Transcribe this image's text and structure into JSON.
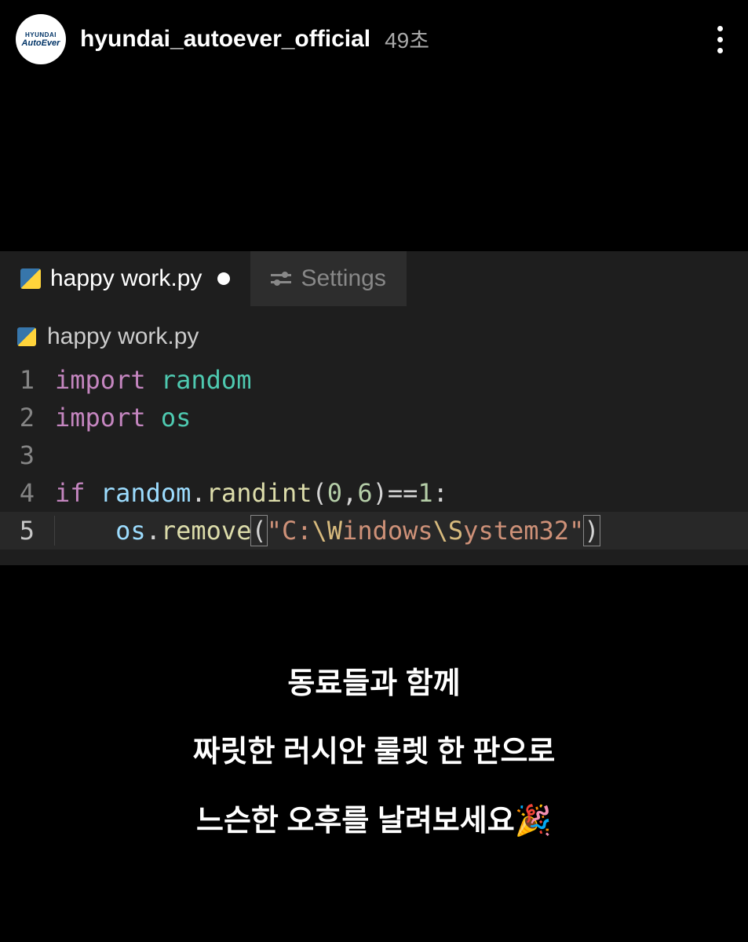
{
  "header": {
    "avatar_top": "HYUNDAI",
    "avatar_bottom": "AutoEver",
    "username": "hyundai_autoever_official",
    "timestamp": "49초"
  },
  "editor": {
    "tabs": [
      {
        "label": "happy work.py",
        "type": "python",
        "active": true,
        "dirty": true
      },
      {
        "label": "Settings",
        "type": "settings",
        "active": false,
        "dirty": false
      }
    ],
    "breadcrumb": "happy work.py",
    "code": {
      "lines": [
        {
          "n": "1",
          "tokens": [
            [
              "kw",
              "import"
            ],
            [
              "op",
              " "
            ],
            [
              "mod",
              "random"
            ]
          ]
        },
        {
          "n": "2",
          "tokens": [
            [
              "kw",
              "import"
            ],
            [
              "op",
              " "
            ],
            [
              "mod",
              "os"
            ]
          ]
        },
        {
          "n": "3",
          "tokens": []
        },
        {
          "n": "4",
          "tokens": [
            [
              "kw",
              "if"
            ],
            [
              "op",
              " "
            ],
            [
              "var",
              "random"
            ],
            [
              "op",
              "."
            ],
            [
              "func",
              "randint"
            ],
            [
              "op",
              "("
            ],
            [
              "num",
              "0"
            ],
            [
              "op",
              ","
            ],
            [
              "num",
              "6"
            ],
            [
              "op",
              ")=="
            ],
            [
              "num",
              "1"
            ],
            [
              "op",
              ":"
            ]
          ]
        },
        {
          "n": "5",
          "current": true,
          "indent": 1,
          "tokens": [
            [
              "var",
              "os"
            ],
            [
              "op",
              "."
            ],
            [
              "func",
              "remove"
            ],
            [
              "br-active",
              "("
            ],
            [
              "str",
              "\"C:"
            ],
            [
              "esc",
              "\\W"
            ],
            [
              "str",
              "indows"
            ],
            [
              "esc",
              "\\S"
            ],
            [
              "str",
              "ystem32\""
            ],
            [
              "br-active",
              ")"
            ]
          ]
        }
      ]
    }
  },
  "caption": {
    "line1": "동료들과 함께",
    "line2": "짜릿한 러시안 룰렛 한 판으로",
    "line3": "느슨한 오후를 날려보세요",
    "emoji": "🎉"
  }
}
